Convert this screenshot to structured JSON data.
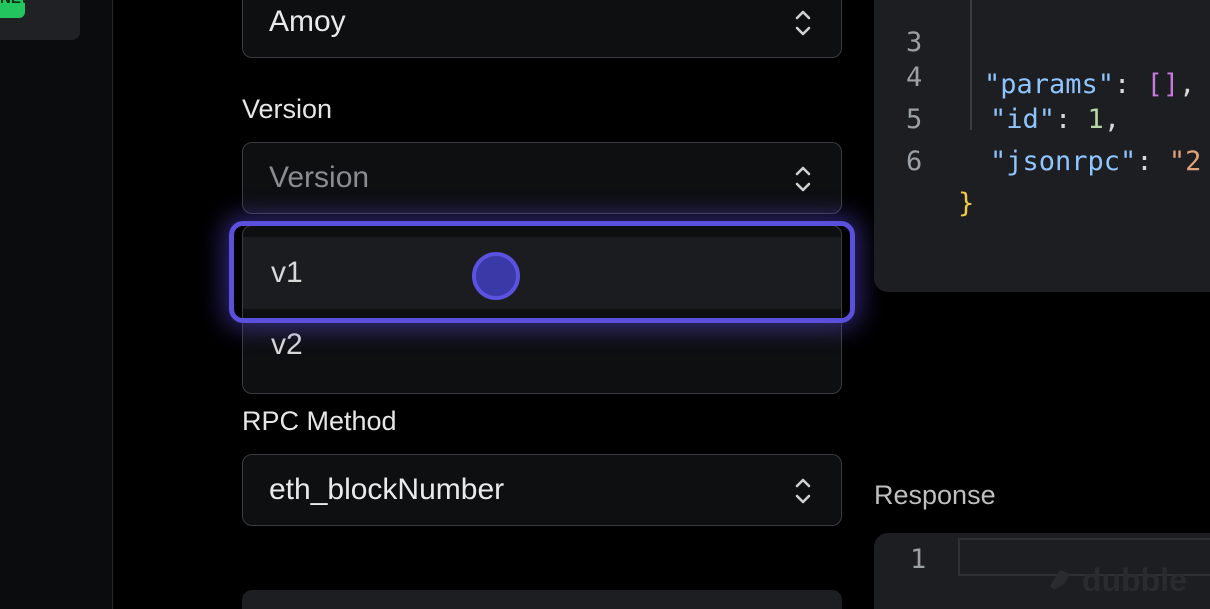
{
  "sidebar": {
    "badge": "NEW"
  },
  "network": {
    "value": "Amoy"
  },
  "version": {
    "label": "Version",
    "placeholder": "Version",
    "options": [
      {
        "label": "v1",
        "highlighted": true
      },
      {
        "label": "v2",
        "highlighted": false
      }
    ]
  },
  "rpc": {
    "label": "RPC Method",
    "value": "eth_blockNumber"
  },
  "request": {
    "lines": [
      {
        "num": "3",
        "text": "\"params\": [],",
        "key": "\"params\"",
        "sep": ": ",
        "val": "[]",
        "tail": ","
      },
      {
        "num": "4",
        "key": "\"id\"",
        "sep": ": ",
        "val": "1",
        "tail": ","
      },
      {
        "num": "5",
        "key": "\"jsonrpc\"",
        "sep": ": ",
        "val": "\"2",
        "tail": ""
      },
      {
        "num": "6",
        "brace": "}"
      }
    ]
  },
  "response": {
    "label": "Response",
    "line_num": "1"
  },
  "watermark": {
    "text": "dubble"
  },
  "colors": {
    "accent": "#5b4fdc",
    "badge": "#22c55e",
    "panel": "#1d1e21"
  }
}
